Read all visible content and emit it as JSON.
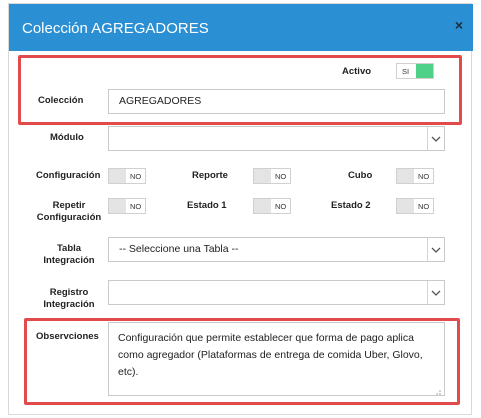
{
  "dialog": {
    "title": "Colección AGREGADORES",
    "close_label": "×"
  },
  "form": {
    "activo": {
      "label": "Activo",
      "value": "SI"
    },
    "coleccion": {
      "label": "Colección",
      "value": "AGREGADORES"
    },
    "modulo": {
      "label": "Módulo",
      "value": ""
    },
    "configuracion": {
      "label": "Configuración",
      "value": "NO"
    },
    "reporte": {
      "label": "Reporte",
      "value": "NO"
    },
    "cubo": {
      "label": "Cubo",
      "value": "NO"
    },
    "repetir_configuracion": {
      "label_line1": "Repetir",
      "label_line2": "Configuración",
      "value": "NO"
    },
    "estado1": {
      "label": "Estado 1",
      "value": "NO"
    },
    "estado2": {
      "label": "Estado 2",
      "value": "NO"
    },
    "tabla_integracion": {
      "label_line1": "Tabla",
      "label_line2": "Integración",
      "value": "-- Seleccione una Tabla --"
    },
    "registro_integracion": {
      "label_line1": "Registro",
      "label_line2": "Integración",
      "value": ""
    },
    "observaciones": {
      "label": "Observciones",
      "value": "Configuración que permite establecer que forma de pago aplica como agregador (Plataformas de entrega de comida Uber, Glovo, etc)."
    }
  },
  "colors": {
    "header": "#2b8fd4",
    "highlight": "#e24b4b",
    "toggle_on": "#4fd18a"
  },
  "icons": {
    "close": "close-icon",
    "caret": "chevron-down-icon",
    "resize": "resize-grip-icon"
  }
}
